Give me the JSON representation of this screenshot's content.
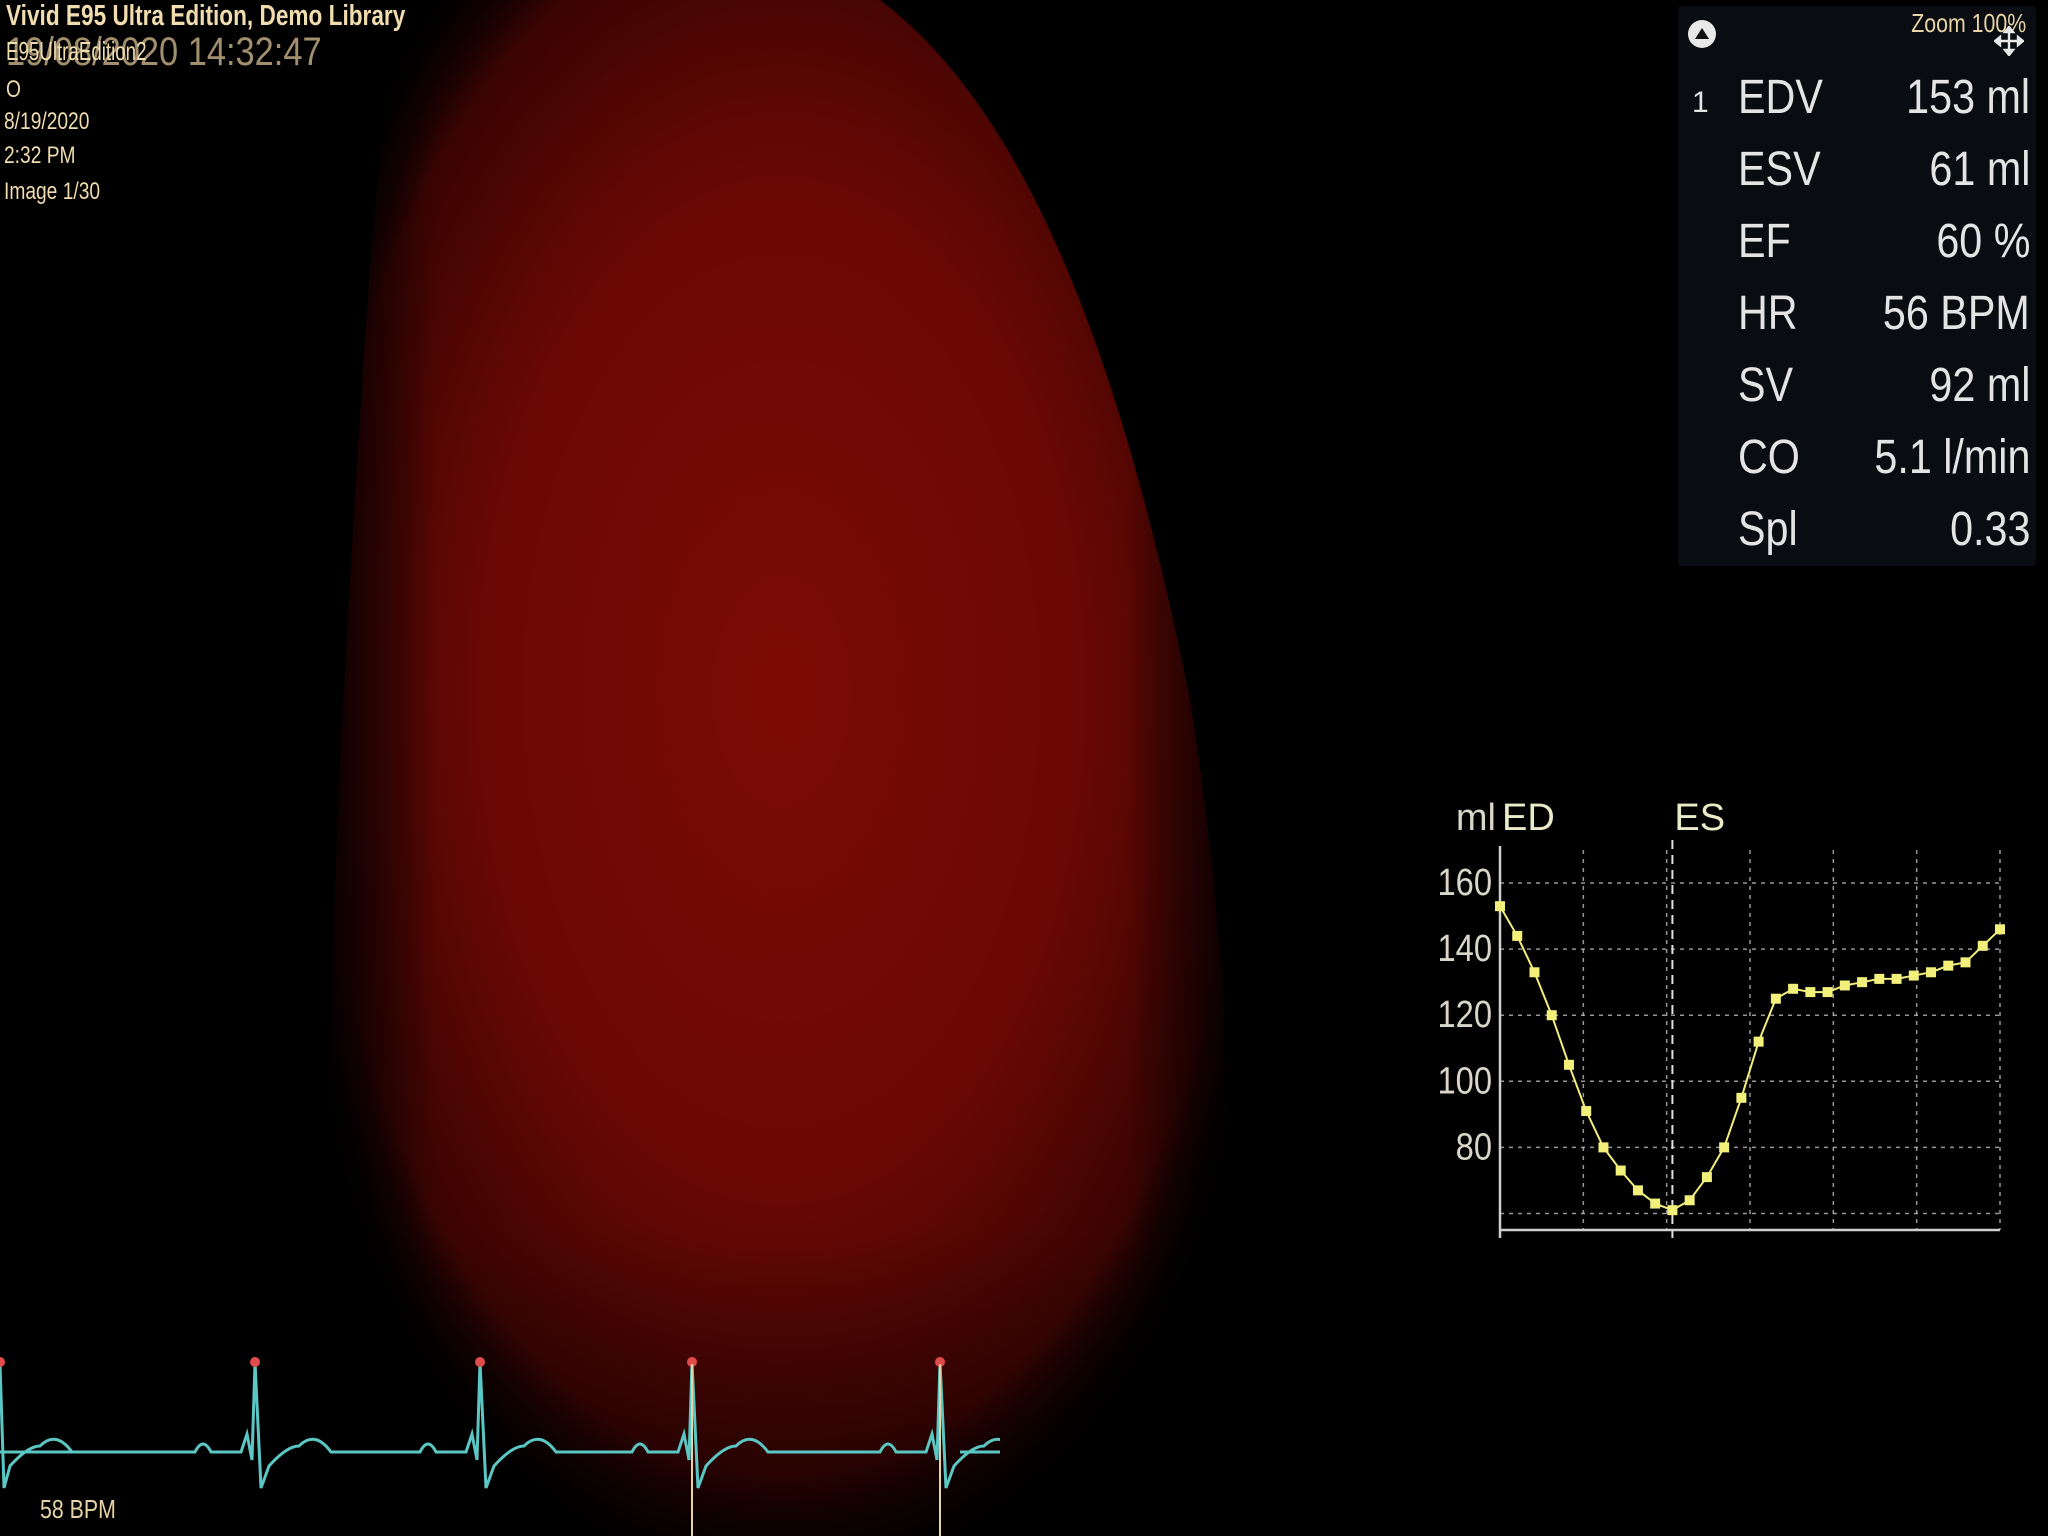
{
  "header": {
    "title": "Vivid E95 Ultra Edition, Demo Library",
    "datetime_overlay": "19/08/2020 14:32:47",
    "subtitle": "E95UltraEdition2",
    "lines": [
      "O",
      "8/19/2020",
      "2:32 PM",
      "Image 1/30"
    ]
  },
  "measurements": {
    "zoom": "Zoom 100%",
    "index": "1",
    "rows": [
      {
        "name": "EDV",
        "value": "153 ml"
      },
      {
        "name": "ESV",
        "value": "61 ml"
      },
      {
        "name": "EF",
        "value": "60 %"
      },
      {
        "name": "HR",
        "value": "56 BPM"
      },
      {
        "name": "SV",
        "value": "92 ml"
      },
      {
        "name": "CO",
        "value": "5.1 l/min"
      },
      {
        "name": "Spl",
        "value": "0.33"
      }
    ]
  },
  "chart_data": {
    "type": "line",
    "unit_label": "ml",
    "markers": [
      {
        "label": "ED",
        "x": 0
      },
      {
        "label": "ES",
        "x": 10
      }
    ],
    "y_ticks": [
      160,
      140,
      120,
      100,
      80
    ],
    "ylim": [
      55,
      170
    ],
    "xlim": [
      0,
      29
    ],
    "x": [
      0,
      1,
      2,
      3,
      4,
      5,
      6,
      7,
      8,
      9,
      10,
      11,
      12,
      13,
      14,
      15,
      16,
      17,
      18,
      19,
      20,
      21,
      22,
      23,
      24,
      25,
      26,
      27,
      28,
      29
    ],
    "values": [
      153,
      144,
      133,
      120,
      105,
      91,
      80,
      73,
      67,
      63,
      61,
      64,
      71,
      80,
      95,
      112,
      125,
      128,
      127,
      127,
      129,
      130,
      131,
      131,
      132,
      133,
      135,
      136,
      141,
      146
    ],
    "grid": true,
    "color": "#f2ef7a"
  },
  "ecg": {
    "bpm_label": "58 BPM",
    "trace_color": "#5bc7c4",
    "marker_color": "#e24b4b"
  },
  "colors": {
    "background": "#000000",
    "volume_red": "#7a0a04",
    "text": "#f0dcae"
  }
}
